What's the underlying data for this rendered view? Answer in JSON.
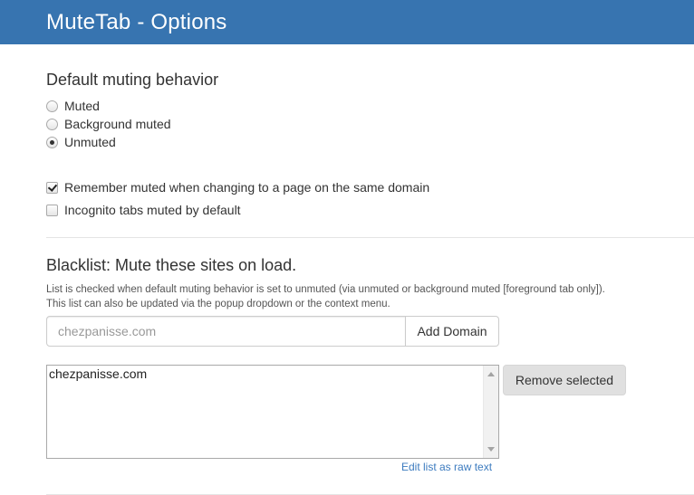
{
  "header": {
    "title": "MuteTab - Options"
  },
  "muting": {
    "title": "Default muting behavior",
    "options": [
      {
        "label": "Muted",
        "checked": false
      },
      {
        "label": "Background muted",
        "checked": false
      },
      {
        "label": "Unmuted",
        "checked": true
      }
    ]
  },
  "settings": {
    "remember_muted": {
      "label": "Remember muted when changing to a page on the same domain",
      "checked": true
    },
    "incognito_muted": {
      "label": "Incognito tabs muted by default",
      "checked": false
    }
  },
  "blacklist": {
    "title": "Blacklist: Mute these sites on load.",
    "help": "List is checked when default muting behavior is set to unmuted (via unmuted or background muted [foreground tab only]). This list can also be updated via the popup dropdown or the context menu.",
    "input_placeholder": "chezpanisse.com",
    "add_label": "Add Domain",
    "items": [
      "chezpanisse.com"
    ],
    "remove_label": "Remove selected",
    "raw_link": "Edit list as raw text"
  },
  "colors": {
    "header_bg": "#3774b0",
    "link": "#3c7bbf",
    "remove_bg": "#e0e0e0"
  },
  "icons": {
    "radio": "radio-button",
    "checkbox": "checkbox",
    "scroll": "scroll-arrow"
  }
}
